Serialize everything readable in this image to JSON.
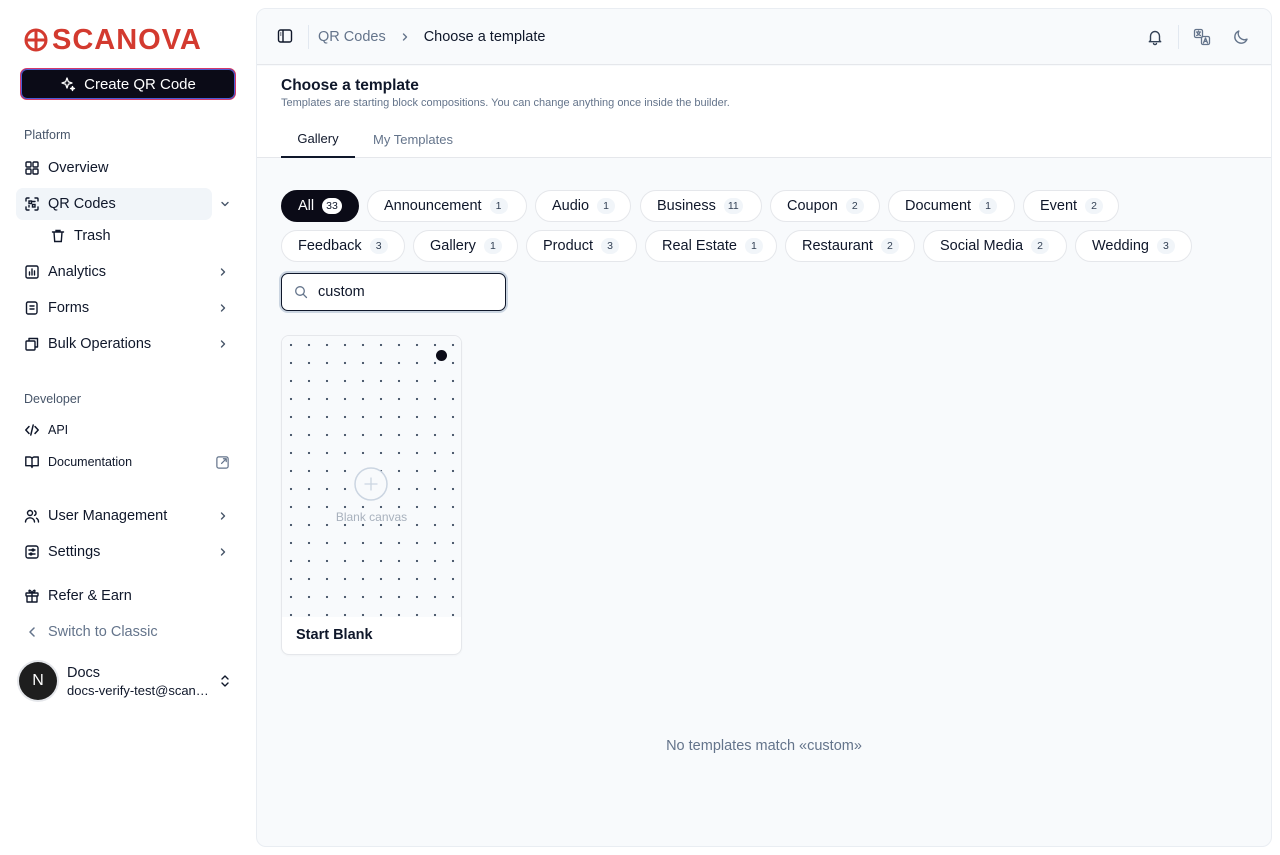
{
  "brand": {
    "name": "SCANOVA",
    "color": "#d33a2f"
  },
  "sidebar": {
    "create_button": "Create QR Code",
    "platform_label": "Platform",
    "overview": "Overview",
    "qr_codes": "QR Codes",
    "trash": "Trash",
    "analytics": "Analytics",
    "forms": "Forms",
    "bulk_operations": "Bulk Operations",
    "developer_label": "Developer",
    "api": "API",
    "documentation": "Documentation",
    "user_management": "User Management",
    "settings": "Settings",
    "refer_earn": "Refer & Earn",
    "switch_classic": "Switch to Classic",
    "user": {
      "avatar_letter": "N",
      "name": "Docs",
      "email": "docs-verify-test@scanova.io"
    }
  },
  "topbar": {
    "breadcrumb_parent": "QR Codes",
    "breadcrumb_current": "Choose a template"
  },
  "page": {
    "title": "Choose a template",
    "subtitle": "Templates are starting block compositions. You can change anything once inside the builder.",
    "tabs": [
      "Gallery",
      "My Templates"
    ]
  },
  "categories": [
    {
      "label": "All",
      "count": "33"
    },
    {
      "label": "Announcement",
      "count": "1"
    },
    {
      "label": "Audio",
      "count": "1"
    },
    {
      "label": "Business",
      "count": "11"
    },
    {
      "label": "Coupon",
      "count": "2"
    },
    {
      "label": "Document",
      "count": "1"
    },
    {
      "label": "Event",
      "count": "2"
    },
    {
      "label": "Feedback",
      "count": "3"
    },
    {
      "label": "Gallery",
      "count": "1"
    },
    {
      "label": "Product",
      "count": "3"
    },
    {
      "label": "Real Estate",
      "count": "1"
    },
    {
      "label": "Restaurant",
      "count": "2"
    },
    {
      "label": "Social Media",
      "count": "2"
    },
    {
      "label": "Wedding",
      "count": "3"
    }
  ],
  "search": {
    "value": "custom"
  },
  "blank_card": {
    "canvas_label": "Blank canvas",
    "title": "Start Blank"
  },
  "empty_message": "No templates match «custom»"
}
